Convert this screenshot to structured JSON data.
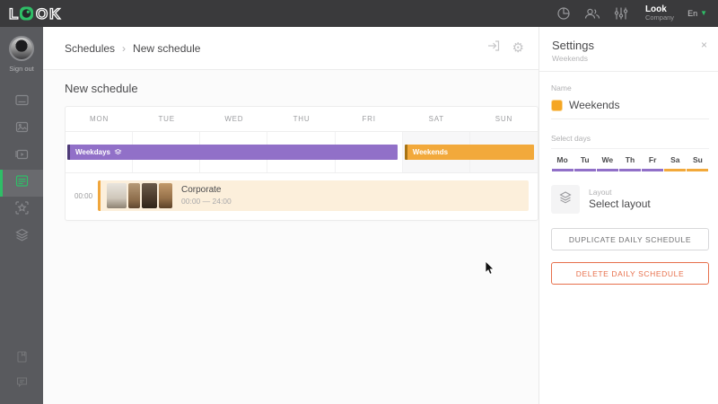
{
  "topbar": {
    "logo": "LOOK",
    "company_name": "Look",
    "company_sub": "Company",
    "language": "En",
    "icons": [
      "stats-icon",
      "users-icon",
      "sliders-icon"
    ]
  },
  "sidebar": {
    "sign_out": "Sign out",
    "items": [
      {
        "name": "displays"
      },
      {
        "name": "images"
      },
      {
        "name": "videos"
      },
      {
        "name": "schedules",
        "active": true
      },
      {
        "name": "widgets"
      },
      {
        "name": "layers"
      }
    ],
    "bottom_items": [
      {
        "name": "documentation"
      },
      {
        "name": "feedback"
      }
    ]
  },
  "breadcrumb": {
    "parent": "Schedules",
    "separator": "›",
    "current": "New schedule"
  },
  "main": {
    "title": "New schedule",
    "calendar": {
      "days": [
        "MON",
        "TUE",
        "WED",
        "THU",
        "FRI",
        "SAT",
        "SUN"
      ],
      "bands": {
        "weekdays": {
          "label": "Weekdays",
          "color": "#9170c8",
          "span": [
            "MON",
            "FRI"
          ]
        },
        "weekends": {
          "label": "Weekends",
          "color": "#f2a93b",
          "span": [
            "SAT",
            "SUN"
          ]
        }
      },
      "schedule_row": {
        "time": "00:00",
        "title": "Corporate",
        "time_range": "00:00 — 24:00",
        "thumbnails_count": 4
      }
    }
  },
  "settings": {
    "title": "Settings",
    "subtitle": "Weekends",
    "close": "×",
    "name_label": "Name",
    "name_value": "Weekends",
    "name_swatch_color": "#f5a623",
    "select_days_label": "Select days",
    "days": [
      "Mo",
      "Tu",
      "We",
      "Th",
      "Fr",
      "Sa",
      "Su"
    ],
    "day_accents": {
      "weekday": "#9170c8",
      "weekend": "#f2a93b"
    },
    "layout_label": "Layout",
    "layout_value": "Select layout",
    "duplicate_button": "DUPLICATE DAILY SCHEDULE",
    "delete_button": "DELETE DAILY SCHEDULE"
  },
  "colors": {
    "brand_green": "#2fbe67",
    "topbar_bg": "#3a3a3c",
    "sidebar_bg": "#595a5e",
    "delete_accent": "#e7704c"
  }
}
